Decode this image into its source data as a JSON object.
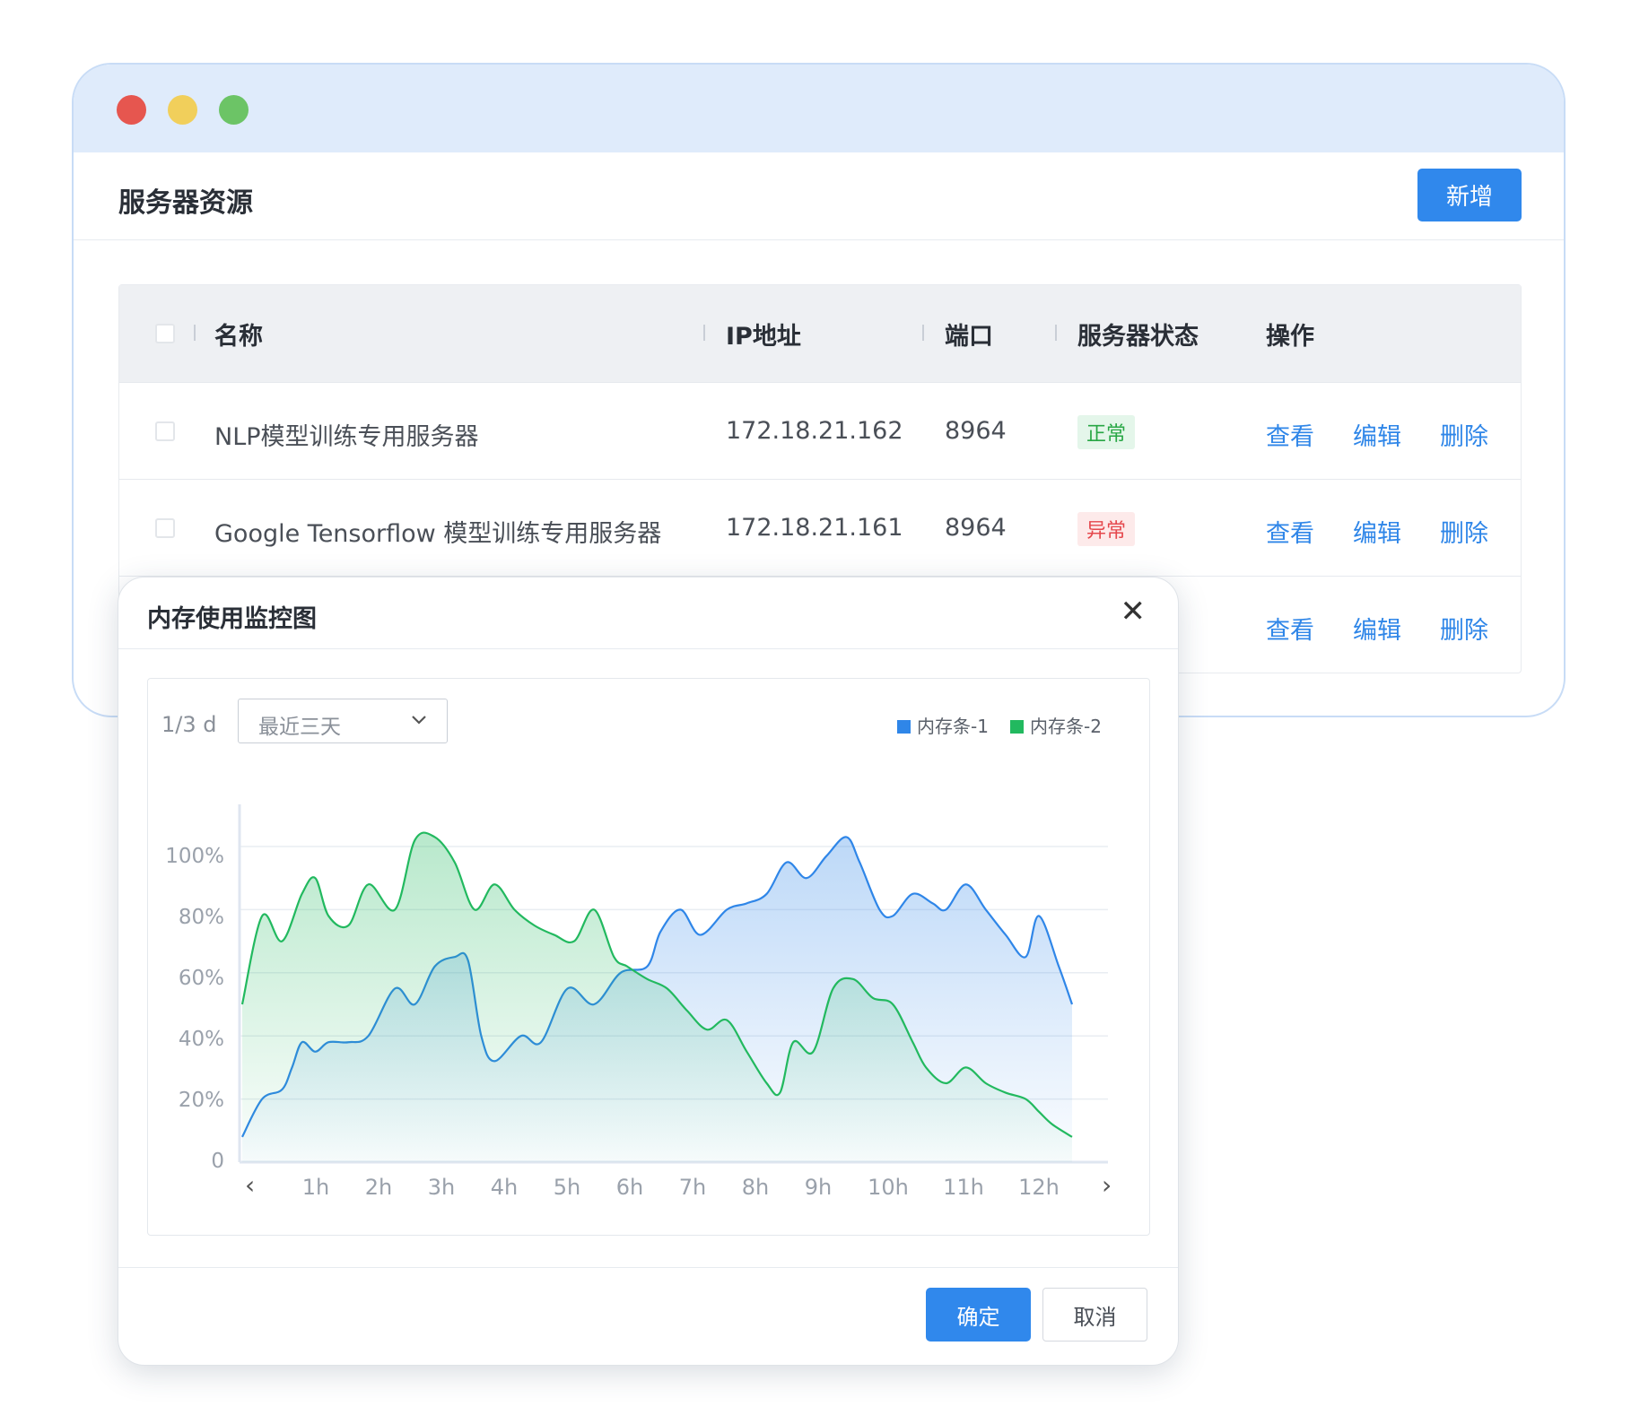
{
  "window": {
    "controls": [
      "close-dot",
      "minimize-dot",
      "maximize-dot"
    ],
    "colors": {
      "close": "#e6564f",
      "minimize": "#f1cf5b",
      "maximize": "#6cc466"
    }
  },
  "page": {
    "title": "服务器资源",
    "add_label": "新增"
  },
  "table": {
    "headers": {
      "name": "名称",
      "ip": "IP地址",
      "port": "端口",
      "status": "服务器状态",
      "actions": "操作"
    },
    "rows": [
      {
        "name": "NLP模型训练专用服务器",
        "ip": "172.18.21.162",
        "port": "8964",
        "status": "正常",
        "status_type": "ok",
        "view": "查看",
        "edit": "编辑",
        "delete": "删除"
      },
      {
        "name": "Google Tensorflow 模型训练专用服务器",
        "ip": "172.18.21.161",
        "port": "8964",
        "status": "异常",
        "status_type": "error",
        "view": "查看",
        "edit": "编辑",
        "delete": "删除"
      },
      {
        "name": "",
        "ip": "",
        "port": "",
        "status": "",
        "view": "查看",
        "edit": "编辑",
        "delete": "删除"
      }
    ]
  },
  "modal": {
    "title": "内存使用监控图",
    "close_icon": "close-icon",
    "range_label": "1/3 d",
    "select_value": "最近三天",
    "ok_label": "确定",
    "cancel_label": "取消"
  },
  "chart_data": {
    "type": "area",
    "x": [
      "1h",
      "2h",
      "3h",
      "4h",
      "5h",
      "6h",
      "7h",
      "8h",
      "9h",
      "10h",
      "11h",
      "12h"
    ],
    "ylim": [
      0,
      100
    ],
    "yticks": [
      "0",
      "20%",
      "40%",
      "60%",
      "80%",
      "100%"
    ],
    "series": [
      {
        "name": "内存条-1",
        "color": "#2f86e8",
        "points": [
          [
            0,
            8
          ],
          [
            0.3,
            20
          ],
          [
            0.6,
            23
          ],
          [
            0.75,
            30
          ],
          [
            0.9,
            38
          ],
          [
            1.1,
            35
          ],
          [
            1.3,
            38
          ],
          [
            1.6,
            38
          ],
          [
            1.9,
            40
          ],
          [
            2.3,
            55
          ],
          [
            2.6,
            50
          ],
          [
            2.9,
            62
          ],
          [
            3.2,
            65
          ],
          [
            3.4,
            64
          ],
          [
            3.6,
            40
          ],
          [
            3.8,
            32
          ],
          [
            4.2,
            40
          ],
          [
            4.5,
            38
          ],
          [
            4.9,
            55
          ],
          [
            5.3,
            50
          ],
          [
            5.7,
            60
          ],
          [
            6.1,
            62
          ],
          [
            6.3,
            73
          ],
          [
            6.6,
            80
          ],
          [
            6.9,
            72
          ],
          [
            7.3,
            80
          ],
          [
            7.6,
            82
          ],
          [
            7.9,
            85
          ],
          [
            8.2,
            95
          ],
          [
            8.5,
            90
          ],
          [
            8.8,
            97
          ],
          [
            9.1,
            103
          ],
          [
            9.3,
            95
          ],
          [
            9.6,
            80
          ],
          [
            9.8,
            78
          ],
          [
            10.1,
            85
          ],
          [
            10.4,
            82
          ],
          [
            10.6,
            80
          ],
          [
            10.9,
            88
          ],
          [
            11.2,
            80
          ],
          [
            11.5,
            72
          ],
          [
            11.8,
            65
          ],
          [
            12.0,
            78
          ],
          [
            12.3,
            62
          ],
          [
            12.5,
            50
          ]
        ]
      },
      {
        "name": "内存条-2",
        "color": "#22b95f",
        "points": [
          [
            0,
            50
          ],
          [
            0.3,
            78
          ],
          [
            0.6,
            70
          ],
          [
            0.9,
            85
          ],
          [
            1.1,
            90
          ],
          [
            1.3,
            78
          ],
          [
            1.6,
            75
          ],
          [
            1.9,
            88
          ],
          [
            2.3,
            80
          ],
          [
            2.6,
            102
          ],
          [
            2.9,
            103
          ],
          [
            3.2,
            95
          ],
          [
            3.5,
            80
          ],
          [
            3.8,
            88
          ],
          [
            4.1,
            80
          ],
          [
            4.4,
            75
          ],
          [
            4.7,
            72
          ],
          [
            5.0,
            70
          ],
          [
            5.3,
            80
          ],
          [
            5.6,
            65
          ],
          [
            5.8,
            62
          ],
          [
            6.1,
            58
          ],
          [
            6.4,
            55
          ],
          [
            6.7,
            48
          ],
          [
            7.0,
            42
          ],
          [
            7.3,
            45
          ],
          [
            7.6,
            35
          ],
          [
            7.9,
            25
          ],
          [
            8.1,
            22
          ],
          [
            8.3,
            38
          ],
          [
            8.6,
            35
          ],
          [
            8.9,
            55
          ],
          [
            9.2,
            58
          ],
          [
            9.5,
            52
          ],
          [
            9.8,
            50
          ],
          [
            10.1,
            38
          ],
          [
            10.3,
            30
          ],
          [
            10.6,
            25
          ],
          [
            10.9,
            30
          ],
          [
            11.2,
            25
          ],
          [
            11.5,
            22
          ],
          [
            11.8,
            20
          ],
          [
            12.0,
            16
          ],
          [
            12.2,
            12
          ],
          [
            12.5,
            8
          ]
        ]
      }
    ]
  }
}
